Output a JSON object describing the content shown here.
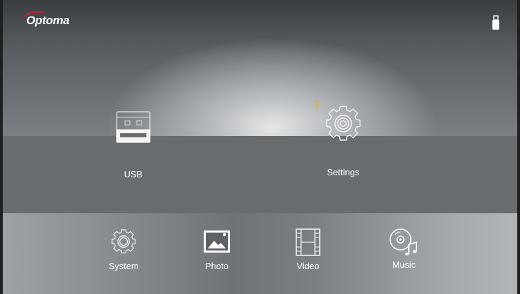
{
  "header": {
    "brand": "Optoma",
    "brand_color": "#cc1f2b",
    "status_icon": "usb-drive-icon"
  },
  "main_menu": [
    {
      "label": "USB",
      "icon": "usb-drive-icon"
    },
    {
      "label": "Settings",
      "icon": "gear-icon"
    }
  ],
  "bottom_menu": [
    {
      "label": "System",
      "icon": "gear-icon"
    },
    {
      "label": "Photo",
      "icon": "photo-icon"
    },
    {
      "label": "Video",
      "icon": "film-icon"
    },
    {
      "label": "Music",
      "icon": "music-disc-icon"
    }
  ]
}
